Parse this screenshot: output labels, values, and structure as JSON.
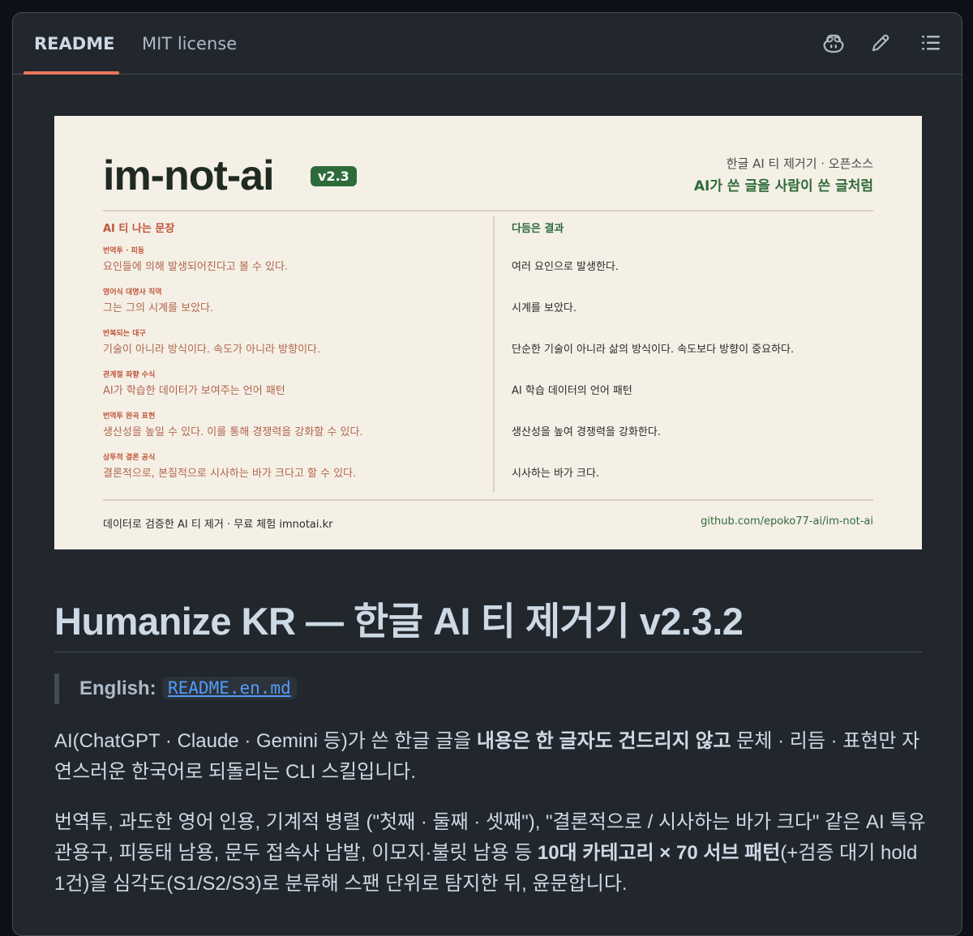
{
  "tabs": {
    "readme": "README",
    "license": "MIT license"
  },
  "toolbar": {
    "icons": [
      "copilot-icon",
      "pencil-icon",
      "list-icon"
    ]
  },
  "banner": {
    "title": "im-not-ai",
    "version": "v2.3",
    "tagline1": "한글 AI 티 제거기 · 오픈소스",
    "tagline2": "AI가 쓴 글을 사람이 쓴 글처럼",
    "left_header": "AI 티 나는 문장",
    "right_header": "다듬은 결과",
    "rows": [
      {
        "label": "번역투 · 피동",
        "before": "요인들에 의해 발생되어진다고 볼 수 있다.",
        "after": "여러 요인으로 발생한다."
      },
      {
        "label": "영어식 대명사 직역",
        "before": "그는 그의 시계를 보았다.",
        "after": "시계를 보았다."
      },
      {
        "label": "반복되는 대구",
        "before": "기술이 아니라 방식이다. 속도가 아니라 방향이다.",
        "after": "단순한 기술이 아니라 삶의 방식이다. 속도보다 방향이 중요하다."
      },
      {
        "label": "관계절 좌향 수식",
        "before": "AI가 학습한 데이터가 보여주는 언어 패턴",
        "after": "AI 학습 데이터의 언어 패턴"
      },
      {
        "label": "번역투 완곡 표현",
        "before": "생산성을 높일 수 있다. 이를 통해 경쟁력을 강화할 수 있다.",
        "after": "생산성을 높여 경쟁력을 강화한다."
      },
      {
        "label": "상투적 결론 공식",
        "before": "결론적으로, 본질적으로 시사하는 바가 크다고 할 수 있다.",
        "after": "시사하는 바가 크다."
      }
    ],
    "footer_left": "데이터로 검증한 AI 티 제거 · 무료 체험 imnotai.kr",
    "footer_right": "github.com/epoko77-ai/im-not-ai"
  },
  "readme": {
    "heading": "Humanize KR — 한글 AI 티 제거기 v2.3.2",
    "quote_label": "English:",
    "quote_link": "README.en.md",
    "p1_a": "AI(ChatGPT · Claude · Gemini 등)가 쓴 한글 글을 ",
    "p1_b": "내용은 한 글자도 건드리지 않고",
    "p1_c": " 문체 · 리듬 · 표현만 자연스러운 한국어로 되돌리는 CLI 스킬입니다.",
    "p2_a": "번역투, 과도한 영어 인용, 기계적 병렬 (\"첫째 · 둘째 · 셋째\"), \"결론적으로 / 시사하는 바가 크다\" 같은 AI 특유 관용구, 피동태 남용, 문두 접속사 남발, 이모지·불릿 남용 등 ",
    "p2_b": "10대 카테고리 × 70 서브 패턴",
    "p2_c": "(+검증 대기 hold 1건)을 심각도(S1/S2/S3)로 분류해 스팬 단위로 탐지한 뒤, 윤문합니다."
  },
  "colors": {
    "accent_underline": "#ec775c",
    "link": "#539bf5",
    "banner_green": "#2e6b3b",
    "banner_bg": "#f5f0e6"
  }
}
